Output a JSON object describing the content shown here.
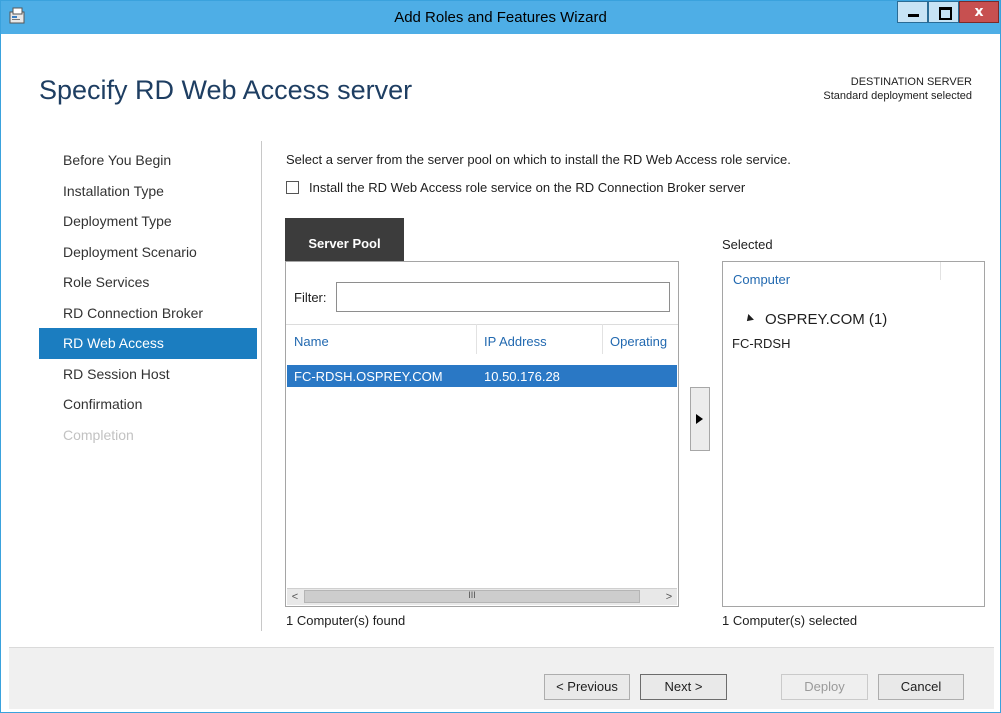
{
  "window": {
    "title": "Add Roles and Features Wizard",
    "minimize_glyph": "",
    "close_glyph": "x"
  },
  "header": {
    "page_title": "Specify RD Web Access server",
    "destination_label": "DESTINATION SERVER",
    "destination_value": "Standard deployment selected"
  },
  "nav": {
    "items": [
      {
        "label": "Before You Begin",
        "state": "normal"
      },
      {
        "label": "Installation Type",
        "state": "normal"
      },
      {
        "label": "Deployment Type",
        "state": "normal"
      },
      {
        "label": "Deployment Scenario",
        "state": "normal"
      },
      {
        "label": "Role Services",
        "state": "normal"
      },
      {
        "label": "RD Connection Broker",
        "state": "normal"
      },
      {
        "label": "RD Web Access",
        "state": "active"
      },
      {
        "label": "RD Session Host",
        "state": "normal"
      },
      {
        "label": "Confirmation",
        "state": "normal"
      },
      {
        "label": "Completion",
        "state": "disabled"
      }
    ]
  },
  "main": {
    "instruction": "Select a server from the server pool on which to install the RD Web Access role service.",
    "checkbox_label": "Install the RD Web Access role service on the RD Connection Broker server",
    "checkbox_checked": false
  },
  "pool": {
    "tab_label": "Server Pool",
    "filter_label": "Filter:",
    "filter_value": "",
    "columns": [
      "Name",
      "IP Address",
      "Operating"
    ],
    "rows": [
      {
        "name": "FC-RDSH.OSPREY.COM",
        "ip": "10.50.176.28",
        "selected": true
      }
    ],
    "scroll_left": "<",
    "scroll_right": ">",
    "scroll_grip": "III",
    "found_text": "1 Computer(s) found"
  },
  "selected": {
    "label": "Selected",
    "column": "Computer",
    "group": "OSPREY.COM (1)",
    "items": [
      "FC-RDSH"
    ],
    "count_text": "1 Computer(s) selected"
  },
  "footer": {
    "previous": "< Previous",
    "next": "Next >",
    "deploy": "Deploy",
    "cancel": "Cancel"
  },
  "colors": {
    "titlebar": "#4eaee6",
    "active_nav": "#1b7dc0",
    "selected_row": "#2a78c5",
    "heading": "#1e3e62",
    "link_header": "#2269b0"
  }
}
